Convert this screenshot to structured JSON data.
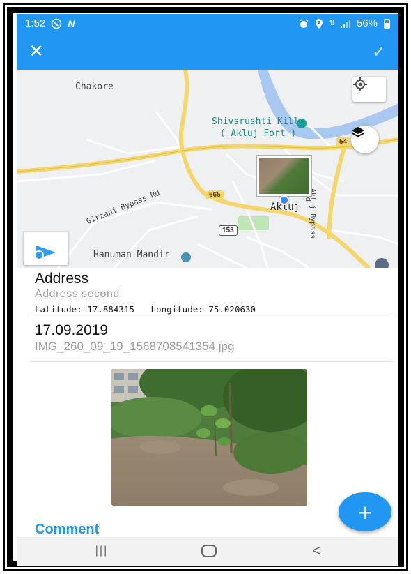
{
  "status_bar": {
    "time": "1:52",
    "battery": "56%",
    "icons": [
      "whatsapp-icon",
      "n-icon",
      "alarm-icon",
      "location-icon",
      "data-icon",
      "signal-icon",
      "battery-icon"
    ]
  },
  "app_bar": {
    "close_icon": "close-icon",
    "confirm_icon": "check-icon",
    "color": "#2196f3"
  },
  "map": {
    "labels": {
      "chakore": "Chakore",
      "fort_line1": "Shivsrushti Killa",
      "fort_line2": "( Akluj Fort )",
      "akluj": "Akluj",
      "girzani": "Girzani Bypass Rd",
      "akluj_bypass": "Akluj Bypass",
      "hanuman": "Hanuman Mandir",
      "road_665": "665",
      "road_153": "153",
      "road_54": "54",
      "rd": "Rd"
    }
  },
  "address": {
    "title": "Address",
    "subtitle": "Address second",
    "latitude_label": "Latitude:",
    "latitude": "17.884315",
    "longitude_label": "Longitude:",
    "longitude": "75.020630"
  },
  "record": {
    "date": "17.09.2019",
    "file_name": "IMG_260_09_19_1568708541354.jpg"
  },
  "comment": {
    "label": "Comment"
  },
  "fab": {
    "label": "+"
  },
  "nav": {
    "recents_label": "|||",
    "back_label": "<"
  }
}
